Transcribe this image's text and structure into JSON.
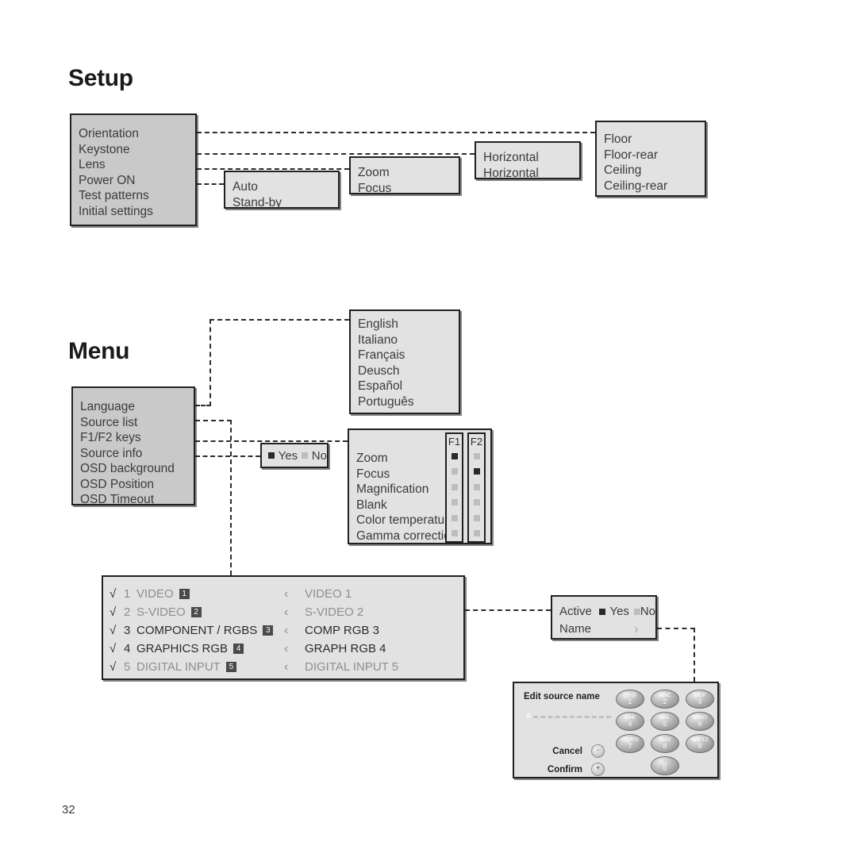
{
  "page": {
    "number": "32"
  },
  "sections": {
    "setup": {
      "title": "Setup",
      "main_menu": {
        "items": [
          "Orientation",
          "Keystone",
          "Lens",
          "Power ON",
          "Test patterns",
          "Initial settings"
        ]
      },
      "orientation_submenu": {
        "items": [
          "Floor",
          "Floor-rear",
          "Ceiling",
          "Ceiling-rear"
        ]
      },
      "keystone_submenu": {
        "items": [
          "Horizontal",
          "Horizontal"
        ]
      },
      "lens_submenu": {
        "items": [
          "Zoom",
          "Focus"
        ]
      },
      "power_on_submenu": {
        "items": [
          "Auto",
          "Stand-by"
        ]
      }
    },
    "menu": {
      "title": "Menu",
      "main_menu": {
        "items": [
          "Language",
          "Source list",
          "F1/F2 keys",
          "Source info",
          "OSD background",
          "OSD Position",
          "OSD Timeout"
        ]
      },
      "language_submenu": {
        "items": [
          "English",
          "Italiano",
          "Français",
          "Deusch",
          "Español",
          "Português"
        ]
      },
      "source_info_toggle": {
        "yes_label": "Yes",
        "no_label": "No",
        "selected": "Yes"
      },
      "f1f2_table": {
        "column_headers": [
          "F1",
          "F2"
        ],
        "rows": [
          {
            "label": "Zoom",
            "f1": true,
            "f2": false
          },
          {
            "label": "Focus",
            "f1": false,
            "f2": true
          },
          {
            "label": "Magnification",
            "f1": false,
            "f2": false
          },
          {
            "label": "Blank",
            "f1": false,
            "f2": false
          },
          {
            "label": "Color temperature",
            "f1": false,
            "f2": false
          },
          {
            "label": "Gamma correction",
            "f1": false,
            "f2": false
          }
        ]
      },
      "source_list": {
        "check_glyph": "√",
        "chevron_glyph": "‹",
        "rows": [
          {
            "num": "1",
            "name": "VIDEO",
            "badge": "1",
            "alias": "VIDEO 1",
            "active": false
          },
          {
            "num": "2",
            "name": "S-VIDEO",
            "badge": "2",
            "alias": "S-VIDEO 2",
            "active": false
          },
          {
            "num": "3",
            "name": "COMPONENT / RGBS",
            "badge": "3",
            "alias": "COMP RGB 3",
            "active": true
          },
          {
            "num": "4",
            "name": "GRAPHICS RGB",
            "badge": "4",
            "alias": "GRAPH RGB 4",
            "active": true
          },
          {
            "num": "5",
            "name": "DIGITAL INPUT",
            "badge": "5",
            "alias": "DIGITAL INPUT 5",
            "active": false
          }
        ]
      },
      "source_detail": {
        "active_label": "Active",
        "yes_label": "Yes",
        "no_label": "No",
        "selected": "Yes",
        "name_label": "Name",
        "name_chevron": "›"
      },
      "edit_source_name": {
        "title": "Edit source name",
        "cancel_label": "Cancel",
        "cancel_symbol": "-",
        "confirm_label": "Confirm",
        "confirm_symbol": "+",
        "keys": [
          {
            "letters": "()?@",
            "number": "1"
          },
          {
            "letters": "ABC",
            "number": "2"
          },
          {
            "letters": "DEF",
            "number": "3"
          },
          {
            "letters": "GHI",
            "number": "4"
          },
          {
            "letters": "JKL",
            "number": "5"
          },
          {
            "letters": "MNO",
            "number": "6"
          },
          {
            "letters": "PQRS",
            "number": "7"
          },
          {
            "letters": "TUV",
            "number": "8"
          },
          {
            "letters": "WXYZ",
            "number": "9"
          },
          {
            "letters": "␣",
            "number": "0"
          }
        ]
      }
    }
  },
  "colors": {
    "box_fill": "#e2e2e2",
    "box_fill_dark": "#c9c9c9",
    "outline": "#231f20",
    "marker_on": "#2a2a2a",
    "marker_off": "#bdbdbd"
  }
}
